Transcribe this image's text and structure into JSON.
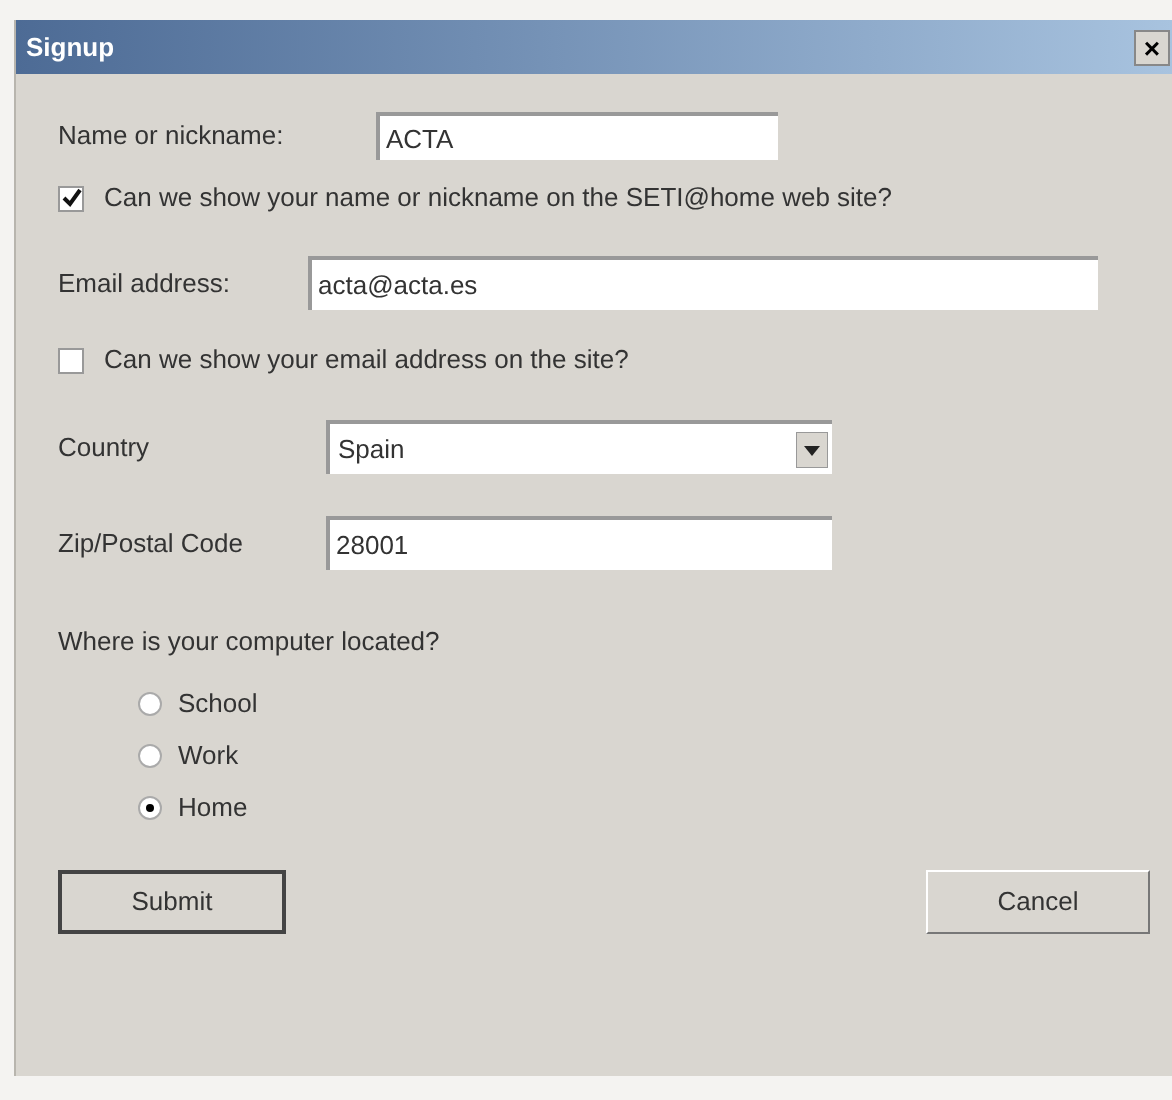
{
  "window": {
    "title": "Signup",
    "close": "×"
  },
  "name_field": {
    "label": "Name or nickname:",
    "value": "ACTA"
  },
  "show_name": {
    "label": "Can we show your name or nickname on the SETI@home web site?",
    "checked": true
  },
  "email_field": {
    "label": "Email address:",
    "value": "acta@acta.es"
  },
  "show_email": {
    "label": "Can we show your email address on the site?",
    "checked": false
  },
  "country": {
    "label": "Country",
    "value": "Spain"
  },
  "zip_field": {
    "label": "Zip/Postal Code",
    "value": "28001"
  },
  "location": {
    "question": "Where is your computer located?",
    "options": [
      {
        "label": "School",
        "selected": false
      },
      {
        "label": "Work",
        "selected": false
      },
      {
        "label": "Home",
        "selected": true
      }
    ]
  },
  "buttons": [
    {
      "label": "Submit",
      "default": true
    },
    {
      "label": "Cancel",
      "default": false
    }
  ]
}
